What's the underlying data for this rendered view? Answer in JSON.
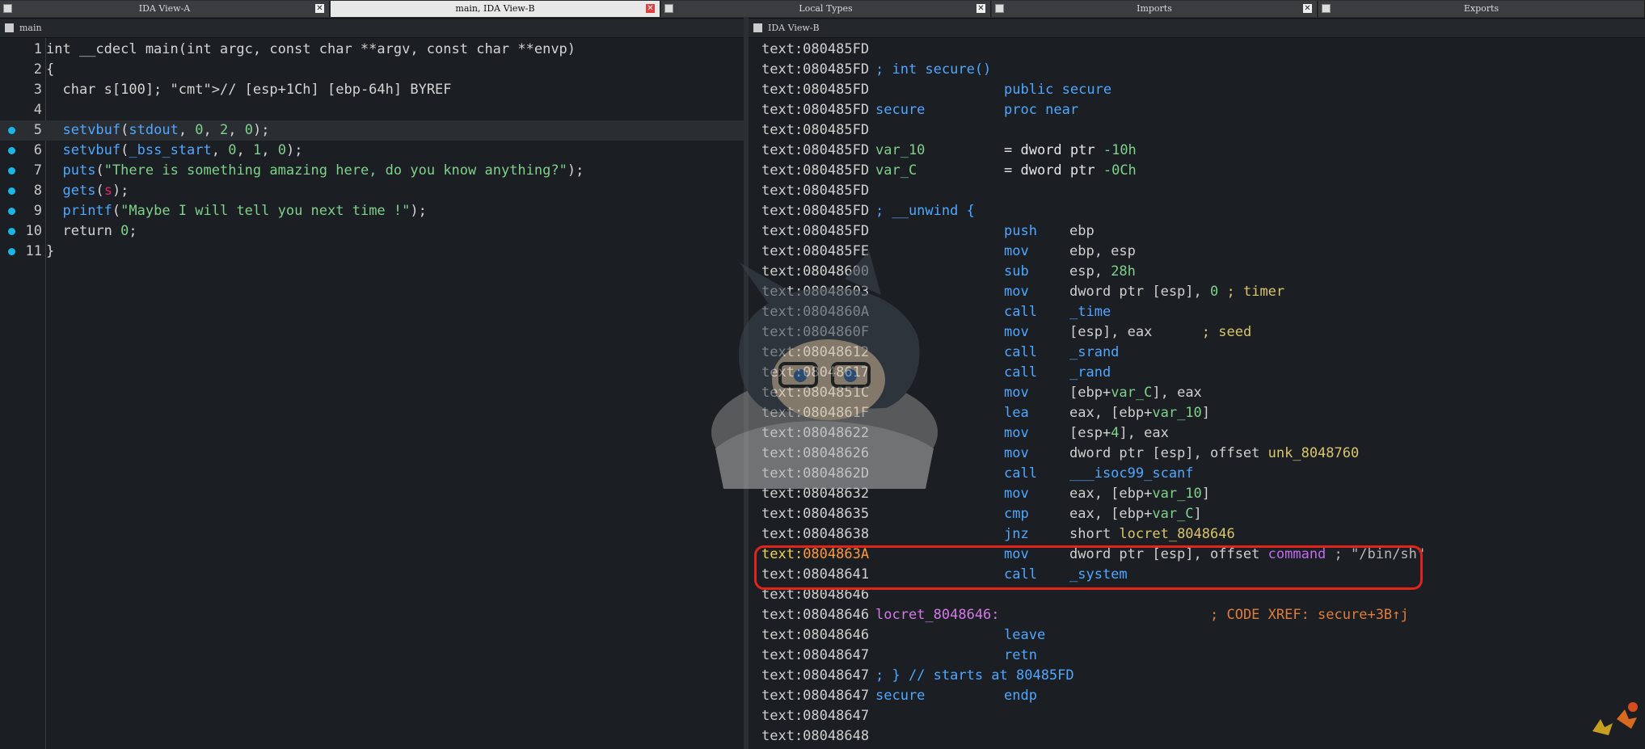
{
  "tabs": [
    {
      "label": "IDA View-A"
    },
    {
      "label": "main, IDA View-B",
      "active": true
    },
    {
      "label": "Local Types"
    },
    {
      "label": "Imports"
    },
    {
      "label": "Exports"
    }
  ],
  "left_pane": {
    "title": "main",
    "lines": [
      {
        "n": "1",
        "t": "int __cdecl main(int argc, const char **argv, const char **envp)"
      },
      {
        "n": "2",
        "t": "{"
      },
      {
        "n": "3",
        "t": "  char s[100]; // [esp+1Ch] [ebp-64h] BYREF"
      },
      {
        "n": "4",
        "t": ""
      },
      {
        "n": "5",
        "t": "  setvbuf(stdout, 0, 2, 0);"
      },
      {
        "n": "6",
        "t": "  setvbuf(_bss_start, 0, 1, 0);"
      },
      {
        "n": "7",
        "t": "  puts(\"There is something amazing here, do you know anything?\");"
      },
      {
        "n": "8",
        "t": "  gets(s);"
      },
      {
        "n": "9",
        "t": "  printf(\"Maybe I will tell you next time !\");"
      },
      {
        "n": "10",
        "t": "  return 0;"
      },
      {
        "n": "11",
        "t": "}"
      }
    ]
  },
  "right_pane": {
    "title": "IDA View-B",
    "lines": [
      {
        "addr": "text:080485FD",
        "label": "",
        "mn": "",
        "op": ""
      },
      {
        "addr": "text:080485FD",
        "label": "; int secure()",
        "mn": "",
        "op": ""
      },
      {
        "addr": "text:080485FD",
        "label": "",
        "mn": "public secure",
        "op": ""
      },
      {
        "addr": "text:080485FD",
        "label": "secure",
        "mn": "proc near",
        "op": ""
      },
      {
        "addr": "text:080485FD",
        "label": "",
        "mn": "",
        "op": ""
      },
      {
        "addr": "text:080485FD",
        "label": "var_10",
        "mn": "= dword ptr -10h",
        "op": ""
      },
      {
        "addr": "text:080485FD",
        "label": "var_C",
        "mn": "= dword ptr -0Ch",
        "op": ""
      },
      {
        "addr": "text:080485FD",
        "label": "",
        "mn": "",
        "op": ""
      },
      {
        "addr": "text:080485FD",
        "label": "; __unwind {",
        "mn": "",
        "op": ""
      },
      {
        "addr": "text:080485FD",
        "label": "",
        "mn": "push",
        "op": "ebp"
      },
      {
        "addr": "text:080485FE",
        "label": "",
        "mn": "mov",
        "op": "ebp, esp"
      },
      {
        "addr": "text:08048600",
        "label": "",
        "mn": "sub",
        "op": "esp, 28h"
      },
      {
        "addr": "text:08048603",
        "label": "",
        "mn": "mov",
        "op": "dword ptr [esp], 0 ; timer"
      },
      {
        "addr": "text:0804860A",
        "label": "",
        "mn": "call",
        "op": "_time"
      },
      {
        "addr": "text:0804860F",
        "label": "",
        "mn": "mov",
        "op": "[esp], eax      ; seed"
      },
      {
        "addr": "text:08048612",
        "label": "",
        "mn": "call",
        "op": "_srand"
      },
      {
        "addr": "text:08048617",
        "label": "",
        "mn": "call",
        "op": "_rand"
      },
      {
        "addr": "text:0804851C",
        "label": "",
        "mn": "mov",
        "op": "[ebp+var_C], eax"
      },
      {
        "addr": "text:0804861F",
        "label": "",
        "mn": "lea",
        "op": "eax, [ebp+var_10]"
      },
      {
        "addr": "text:08048622",
        "label": "",
        "mn": "mov",
        "op": "[esp+4], eax"
      },
      {
        "addr": "text:08048626",
        "label": "",
        "mn": "mov",
        "op": "dword ptr [esp], offset unk_8048760"
      },
      {
        "addr": "text:0804862D",
        "label": "",
        "mn": "call",
        "op": "___isoc99_scanf"
      },
      {
        "addr": "text:08048632",
        "label": "",
        "mn": "mov",
        "op": "eax, [ebp+var_10]"
      },
      {
        "addr": "text:08048635",
        "label": "",
        "mn": "cmp",
        "op": "eax, [ebp+var_C]"
      },
      {
        "addr": "text:08048638",
        "label": "",
        "mn": "jnz",
        "op": "short locret_8048646"
      },
      {
        "addr": "text:0804863A",
        "label": "",
        "mn": "mov",
        "op": "dword ptr [esp], offset command ; \"/bin/sh\""
      },
      {
        "addr": "text:08048641",
        "label": "",
        "mn": "call",
        "op": "_system"
      },
      {
        "addr": "text:08048646",
        "label": "",
        "mn": "",
        "op": ""
      },
      {
        "addr": "text:08048646",
        "label": "locret_8048646:",
        "mn": "",
        "op": "; CODE XREF: secure+3B↑j"
      },
      {
        "addr": "text:08048646",
        "label": "",
        "mn": "leave",
        "op": ""
      },
      {
        "addr": "text:08048647",
        "label": "",
        "mn": "retn",
        "op": ""
      },
      {
        "addr": "text:08048647",
        "label": "; } // starts at 80485FD",
        "mn": "",
        "op": ""
      },
      {
        "addr": "text:08048647",
        "label": "secure",
        "mn": "endp",
        "op": ""
      },
      {
        "addr": "text:08048647",
        "label": "",
        "mn": "",
        "op": ""
      },
      {
        "addr": "text:08048648",
        "label": "",
        "mn": "",
        "op": ""
      }
    ]
  }
}
